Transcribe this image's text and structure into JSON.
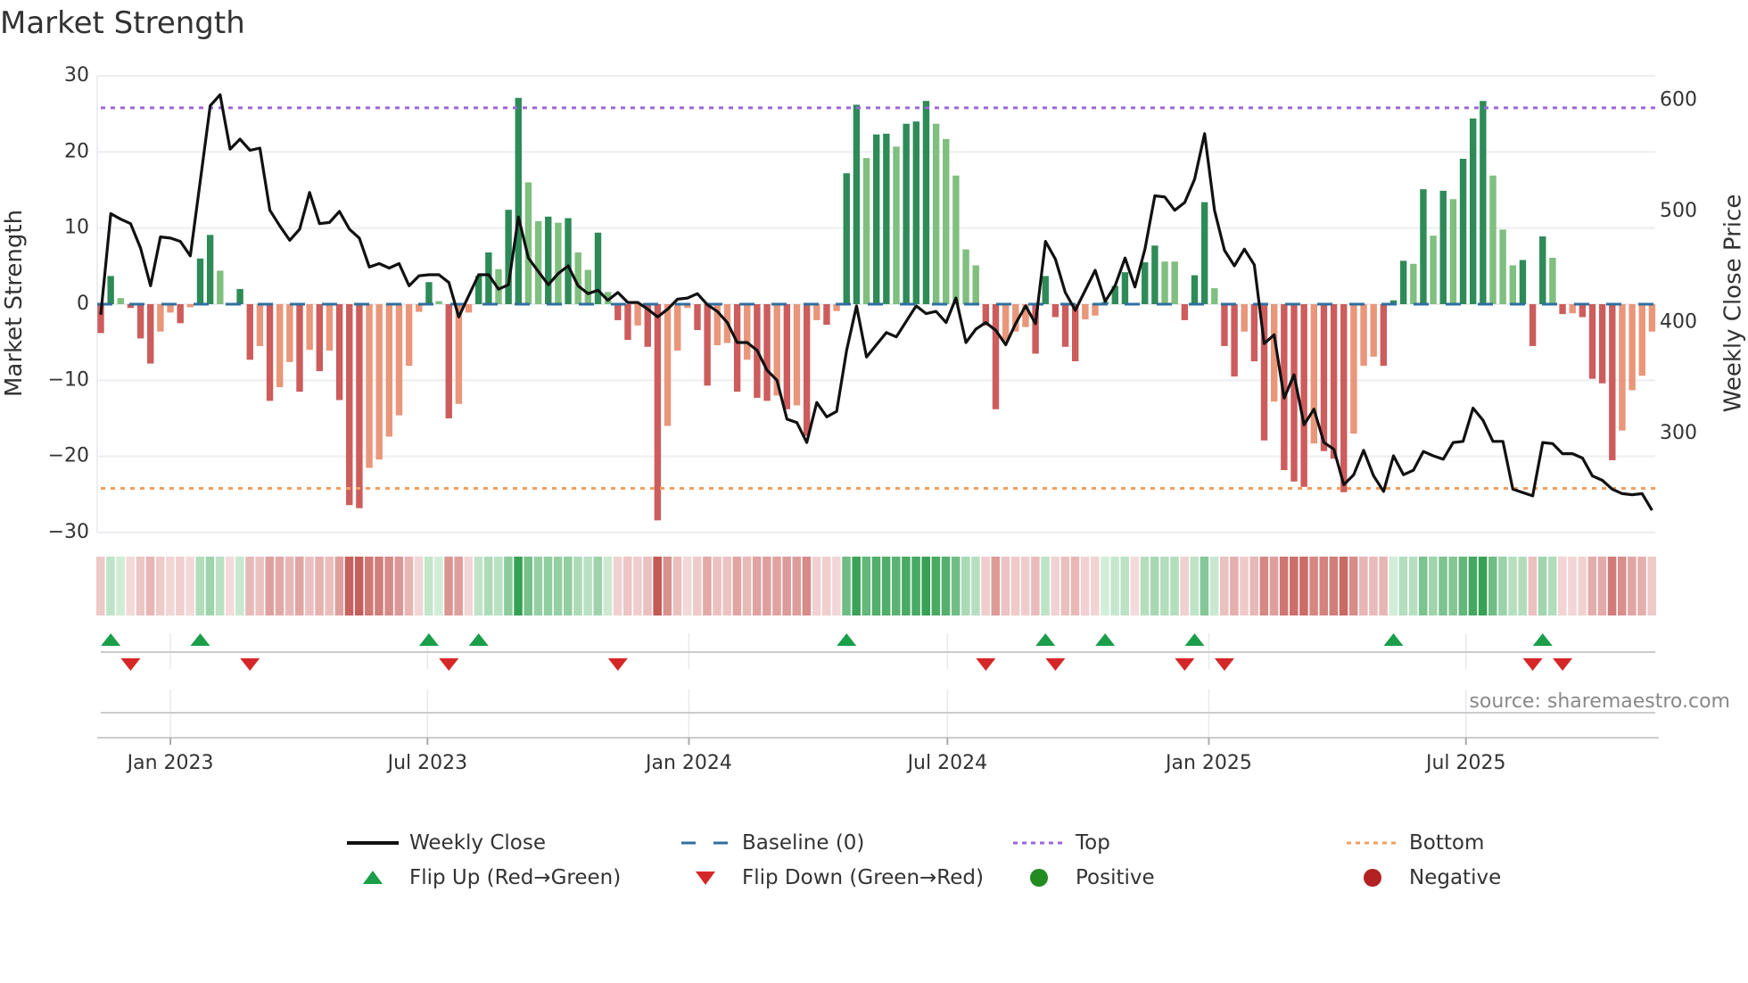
{
  "title": "Market Strength",
  "source": "source: sharemaestro.com",
  "legend": {
    "weekly_close": "Weekly Close",
    "baseline": "Baseline (0)",
    "top": "Top",
    "bottom": "Bottom",
    "flip_up": "Flip Up (Red→Green)",
    "flip_down": "Flip Down (Green→Red)",
    "positive": "Positive",
    "negative": "Negative"
  },
  "colors": {
    "strong_green": "#2e8b57",
    "weak_green": "#7fbf7f",
    "strong_red": "#cd5c5c",
    "weak_red": "#e9967a",
    "close_line": "#111111",
    "baseline": "#2f6f9f",
    "top": "#9b66dd",
    "bottom": "#f0a060",
    "flip_up": "#1a9e4a",
    "flip_down": "#d62728",
    "positive": "#228b22",
    "negative": "#b22222"
  },
  "chart_data": {
    "type": "bar",
    "title": "Market Strength",
    "ylabel": "Market Strength",
    "y2label": "Weekly Close Price",
    "ylim": [
      -30,
      30
    ],
    "y2lim": [
      211,
      622
    ],
    "yticks": [
      "30",
      "20",
      "10",
      "0",
      "−10",
      "−20",
      "−30"
    ],
    "ytick_values": [
      30,
      20,
      10,
      0,
      -10,
      -20,
      -30
    ],
    "y2ticks": [
      "600",
      "500",
      "400",
      "300"
    ],
    "y2tick_values": [
      600,
      500,
      400,
      300
    ],
    "grid": true,
    "interval": "weekly",
    "start_week": "2022-11-13",
    "xticks": [
      {
        "label": "Jan 2023",
        "date": "2023-01-01"
      },
      {
        "label": "Jul 2023",
        "date": "2023-07-01"
      },
      {
        "label": "Jan 2024",
        "date": "2024-01-01"
      },
      {
        "label": "Jul 2024",
        "date": "2024-07-01"
      },
      {
        "label": "Jan 2025",
        "date": "2025-01-01"
      },
      {
        "label": "Jul 2025",
        "date": "2025-07-01"
      }
    ],
    "top_level": 25.8,
    "bottom_level": -24.2,
    "baseline": 0,
    "strength": [
      -3.8,
      3.7,
      0.8,
      -0.5,
      -4.5,
      -7.8,
      -3.6,
      -1.1,
      -2.5,
      -0.4,
      6.0,
      9.1,
      4.4,
      0,
      2.0,
      -7.3,
      -5.5,
      -12.7,
      -10.9,
      -7.6,
      -11.5,
      -6.0,
      -8.8,
      -6.1,
      -12.6,
      -26.4,
      -26.8,
      -21.5,
      -20.4,
      -17.4,
      -14.6,
      -8.1,
      -1.0,
      2.9,
      0.4,
      -15.0,
      -13.1,
      -1.1,
      3.7,
      6.8,
      4.6,
      12.4,
      27.1,
      16.0,
      10.9,
      11.5,
      10.7,
      11.3,
      6.8,
      4.5,
      9.4,
      1.6,
      -2.1,
      -4.7,
      -2.8,
      -5.6,
      -28.4,
      -16.0,
      -6.1,
      -0.5,
      -3.4,
      -10.7,
      -5.4,
      -5.1,
      -11.5,
      -7.3,
      -12.3,
      -12.7,
      -12.0,
      -13.8,
      -13.3,
      -17.3,
      -2.1,
      -2.7,
      -0.9,
      17.2,
      26.2,
      19.2,
      22.3,
      22.4,
      20.7,
      23.7,
      24.0,
      26.7,
      23.7,
      21.7,
      16.9,
      7.2,
      5.1,
      -2.8,
      -13.8,
      -4.8,
      -3.6,
      -3.0,
      -6.5,
      3.7,
      -1.7,
      -5.6,
      -7.5,
      -2.0,
      -1.5,
      0.3,
      2.4,
      4.2,
      0,
      5.5,
      7.7,
      5.6,
      5.6,
      -2.1,
      3.8,
      13.4,
      2.1,
      -5.5,
      -9.5,
      -3.6,
      -7.5,
      -17.9,
      -12.8,
      -21.8,
      -23.3,
      -24.0,
      -18.3,
      -19.3,
      -20.3,
      -24.7,
      -17.0,
      -8.1,
      -6.9,
      -8.1,
      0.5,
      5.7,
      5.3,
      15.1,
      9.0,
      14.9,
      13.8,
      19.1,
      24.4,
      26.7,
      16.9,
      9.8,
      5.1,
      5.8,
      -5.5,
      8.9,
      6.1,
      -1.3,
      -1.2,
      -1.7,
      -9.8,
      -10.4,
      -20.5,
      -16.6,
      -11.3,
      -9.4,
      -3.6
    ],
    "strength_shade": [
      "d",
      "d",
      "l",
      "d",
      "d",
      "d",
      "l",
      "l",
      "d",
      "l",
      "d",
      "d",
      "l",
      "l",
      "d",
      "d",
      "l",
      "d",
      "l",
      "l",
      "d",
      "l",
      "d",
      "l",
      "d",
      "d",
      "d",
      "l",
      "l",
      "l",
      "l",
      "l",
      "l",
      "d",
      "l",
      "d",
      "l",
      "l",
      "d",
      "d",
      "l",
      "d",
      "d",
      "l",
      "l",
      "d",
      "l",
      "d",
      "l",
      "l",
      "d",
      "l",
      "d",
      "d",
      "l",
      "d",
      "d",
      "l",
      "l",
      "l",
      "d",
      "d",
      "l",
      "l",
      "d",
      "l",
      "d",
      "d",
      "l",
      "d",
      "l",
      "d",
      "l",
      "d",
      "l",
      "d",
      "d",
      "l",
      "d",
      "d",
      "l",
      "d",
      "d",
      "d",
      "l",
      "l",
      "l",
      "l",
      "l",
      "d",
      "d",
      "l",
      "l",
      "l",
      "d",
      "d",
      "d",
      "d",
      "d",
      "l",
      "l",
      "d",
      "d",
      "d",
      "l",
      "d",
      "d",
      "l",
      "l",
      "d",
      "d",
      "d",
      "l",
      "d",
      "d",
      "l",
      "d",
      "d",
      "l",
      "d",
      "d",
      "d",
      "l",
      "d",
      "d",
      "d",
      "l",
      "l",
      "l",
      "d",
      "d",
      "d",
      "l",
      "d",
      "l",
      "d",
      "l",
      "d",
      "d",
      "d",
      "l",
      "l",
      "l",
      "d",
      "d",
      "d",
      "l",
      "d",
      "l",
      "d",
      "d",
      "d",
      "d",
      "l",
      "l",
      "l",
      "l"
    ],
    "weekly_close": [
      407,
      498,
      493,
      489,
      467,
      433,
      477,
      476,
      473,
      460,
      527,
      595,
      605,
      556,
      565,
      555,
      557,
      501,
      487,
      474,
      484,
      517,
      489,
      490,
      500,
      484,
      476,
      450,
      453,
      449,
      453,
      433,
      442,
      443,
      443,
      436,
      405,
      424,
      443,
      443,
      430,
      434,
      495,
      458,
      446,
      434,
      444,
      451,
      433,
      426,
      429,
      420,
      427,
      418,
      418,
      412,
      405,
      412,
      421,
      422,
      426,
      416,
      410,
      400,
      382,
      382,
      375,
      357,
      348,
      313,
      310,
      292,
      328,
      315,
      320,
      375,
      415,
      369,
      380,
      391,
      387,
      401,
      415,
      408,
      410,
      400,
      422,
      382,
      394,
      400,
      393,
      380,
      399,
      415,
      399,
      473,
      457,
      427,
      411,
      429,
      447,
      419,
      433,
      458,
      432,
      466,
      514,
      513,
      501,
      508,
      529,
      570,
      501,
      465,
      451,
      466,
      452,
      381,
      389,
      332,
      353,
      308,
      322,
      292,
      286,
      254,
      263,
      285,
      262,
      248,
      280,
      263,
      267,
      284,
      280,
      277,
      292,
      293,
      323,
      312,
      293,
      293,
      250,
      247,
      244,
      292,
      291,
      282,
      282,
      278,
      262,
      258,
      250,
      246,
      245,
      246,
      231
    ],
    "flip_up_weeks": [
      1,
      10,
      33,
      38,
      75,
      95,
      101,
      110,
      130,
      145
    ],
    "flip_down_weeks": [
      3,
      15,
      35,
      52,
      89,
      96,
      109,
      113,
      144,
      147
    ],
    "legend_position": "bottom"
  }
}
